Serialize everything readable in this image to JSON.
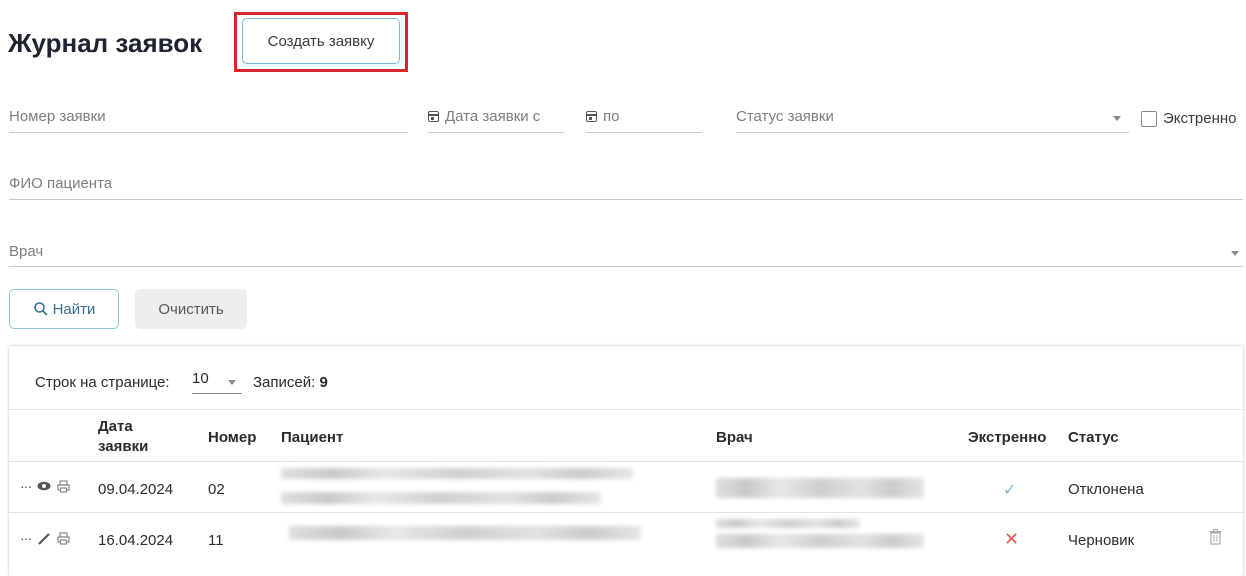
{
  "header": {
    "title": "Журнал заявок",
    "create_label": "Создать заявку"
  },
  "filters": {
    "request_number": "Номер заявки",
    "date_from": "Дата заявки с",
    "date_to": "по",
    "status": "Статус заявки",
    "urgent": "Экстренно",
    "patient": "ФИО пациента",
    "doctor": "Врач"
  },
  "actions": {
    "find_label": "Найти",
    "clear_label": "Очистить"
  },
  "table": {
    "rows_per_page_label": "Строк на странице:",
    "rows_per_page_value": "10",
    "records_label": "Записей:",
    "records_count": "9",
    "columns": {
      "date_line1": "Дата",
      "date_line2": "заявки",
      "number": "Номер",
      "patient": "Пациент",
      "doctor": "Врач",
      "urgent": "Экстренно",
      "status": "Статус"
    },
    "rows": [
      {
        "date": "09.04.2024",
        "number": "02",
        "urgent": "✓",
        "status": "Отклонена"
      },
      {
        "date": "16.04.2024",
        "number": "11",
        "urgent": "✕",
        "status": "Черновик"
      }
    ]
  },
  "icons": [
    "more-icon",
    "eye-icon",
    "print-icon",
    "pencil-icon",
    "calendar-icon",
    "search-icon",
    "trash-icon"
  ]
}
